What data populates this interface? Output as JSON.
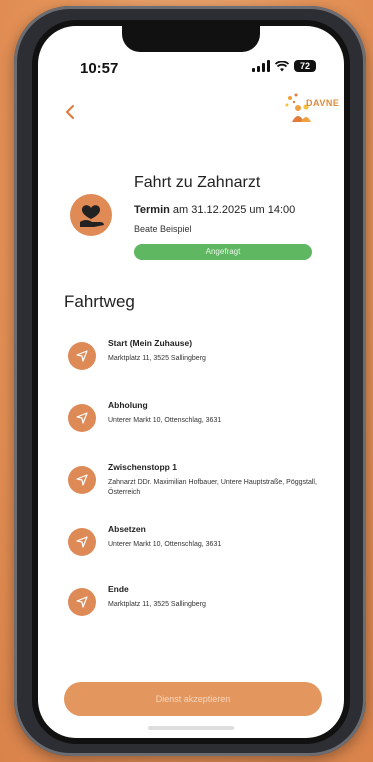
{
  "status": {
    "time": "10:57",
    "battery": "72"
  },
  "header": {
    "back_icon": "chevron-left-icon",
    "logo_text": "DAVNE"
  },
  "ride": {
    "title": "Fahrt zu Zahnarzt",
    "termin_label": "Termin",
    "termin_text": "am 31.12.2025 um 14:00",
    "person": "Beate Beispiel",
    "status": "Angefragt",
    "status_color": "#5fb861"
  },
  "route": {
    "title": "Fahrtweg",
    "stops": [
      {
        "label": "Start (Mein Zuhause)",
        "address": "Marktplatz 11, 3525 Sallingberg"
      },
      {
        "label": "Abholung",
        "address": "Unterer Markt 10, Ottenschlag, 3631"
      },
      {
        "label": "Zwischenstopp 1",
        "address": "Zahnarzt DDr. Maximilian Hofbauer, Untere Hauptstraße, Pöggstall, Österreich"
      },
      {
        "label": "Absetzen",
        "address": "Unterer Markt 10, Ottenschlag, 3631"
      },
      {
        "label": "Ende",
        "address": "Marktplatz 11, 3525 Sallingberg"
      }
    ]
  },
  "actions": {
    "accept_label": "Dienst akzeptieren",
    "accent": "#de8a57"
  }
}
